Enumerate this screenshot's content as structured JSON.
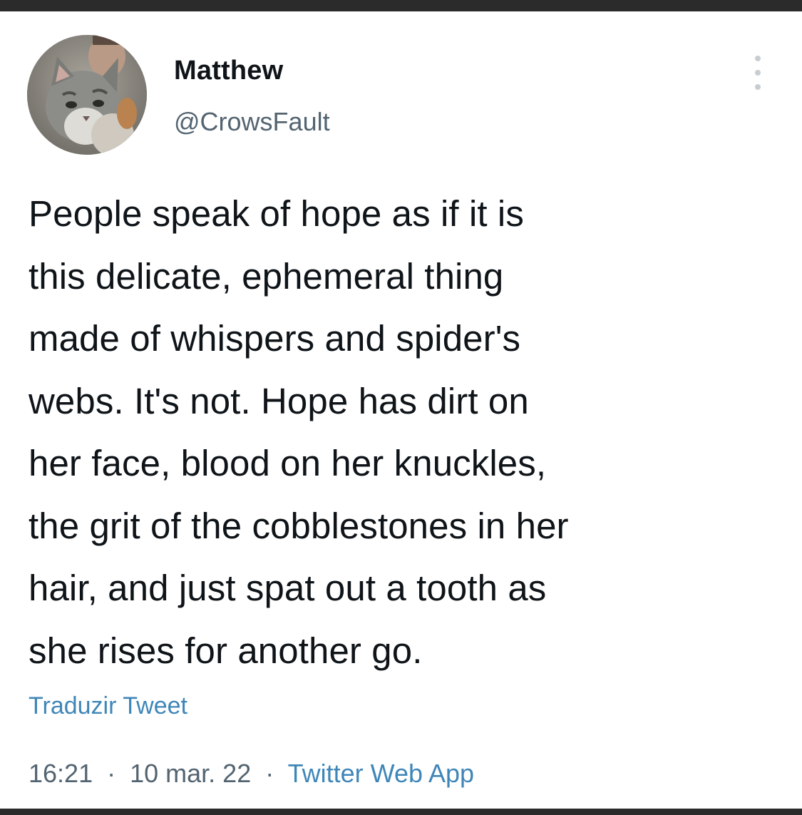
{
  "tweet": {
    "display_name": "Matthew",
    "handle": "@CrowsFault",
    "text_lines": [
      "People speak of hope as if it is",
      "this delicate, ephemeral thing",
      "made of whispers and spider's",
      "webs. It's not. Hope has dirt on",
      "her face, blood on her knuckles,",
      "the grit of the cobblestones in her",
      "hair, and just spat out a tooth as",
      "she rises for another go."
    ],
    "translate_label": "Traduzir Tweet",
    "time": "16:21",
    "separator": "·",
    "date": "10 mar. 22",
    "source": "Twitter Web App"
  },
  "icons": {
    "more": "more-options-icon",
    "avatar": "cat-avatar-image"
  },
  "colors": {
    "primary_text": "#0f1419",
    "secondary_text": "#536471",
    "link": "#3f86b8",
    "frame": "#2b2b2b"
  }
}
